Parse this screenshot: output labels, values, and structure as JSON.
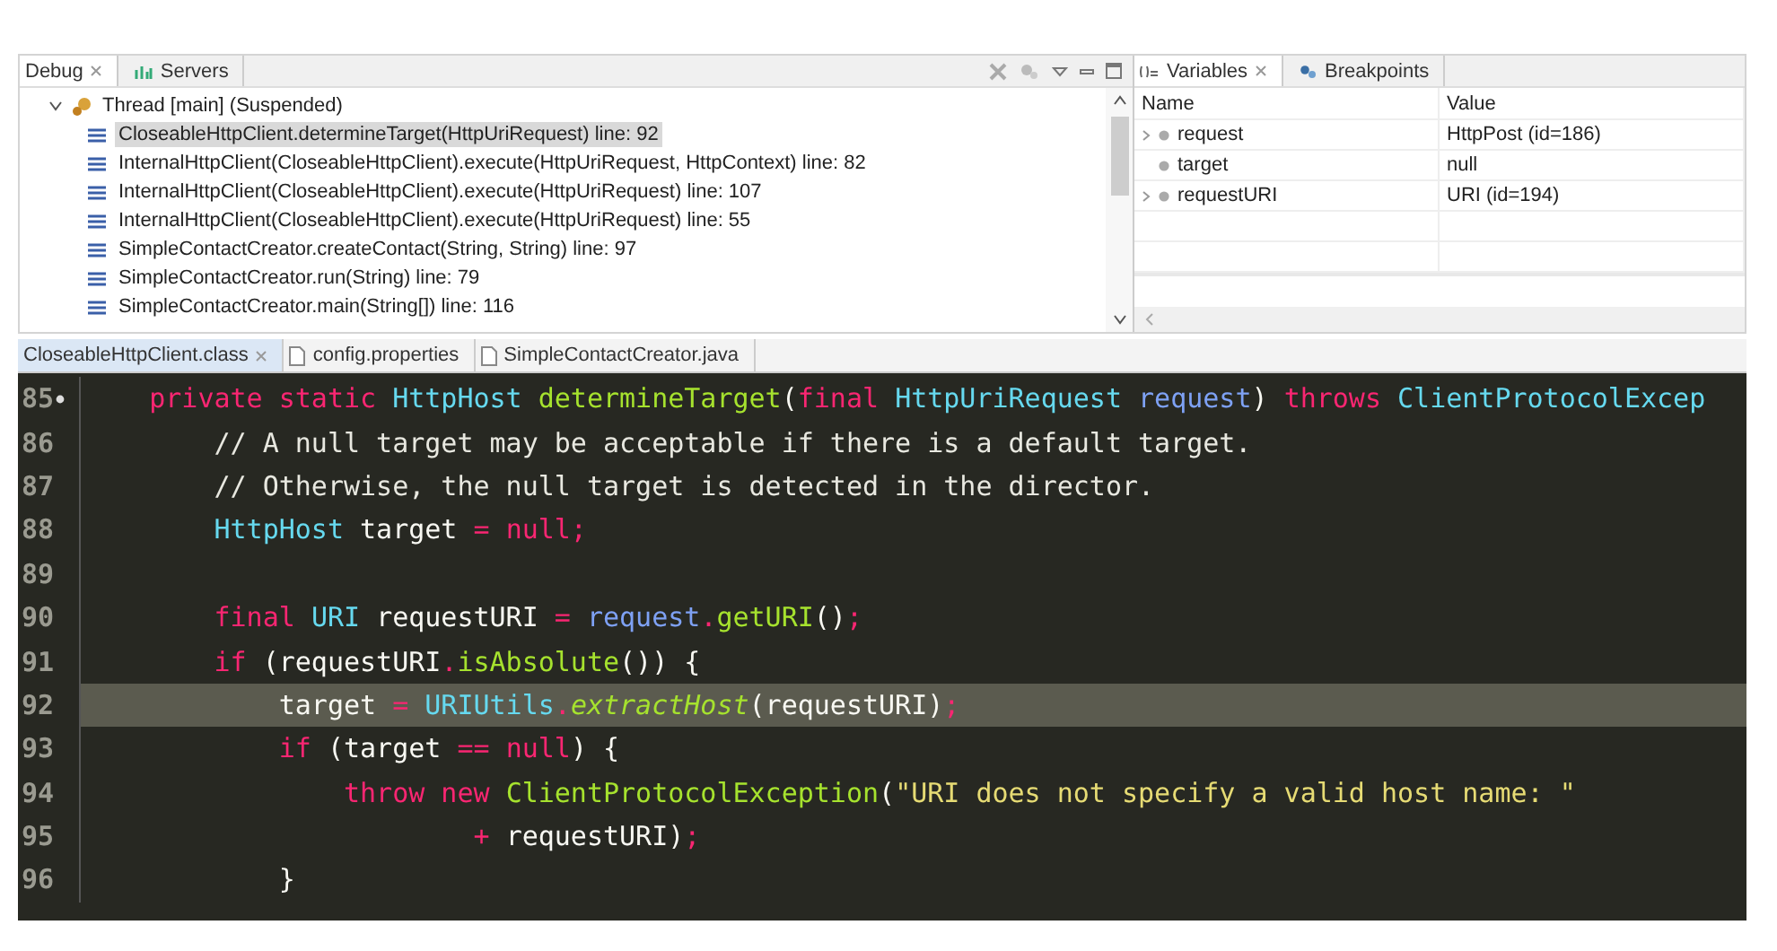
{
  "debug_view": {
    "tabs": [
      {
        "label": "Debug",
        "selected": true
      },
      {
        "label": "Servers",
        "selected": false
      }
    ],
    "thread": {
      "label": "Thread [main] (Suspended)",
      "expanded": true,
      "children": [
        {
          "label": "CloseableHttpClient.determineTarget(HttpUriRequest) line: 92",
          "selected": true
        },
        {
          "label": "InternalHttpClient(CloseableHttpClient).execute(HttpUriRequest, HttpContext) line: 82",
          "selected": false
        },
        {
          "label": "InternalHttpClient(CloseableHttpClient).execute(HttpUriRequest) line: 107",
          "selected": false
        },
        {
          "label": "InternalHttpClient(CloseableHttpClient).execute(HttpUriRequest) line: 55",
          "selected": false
        },
        {
          "label": "SimpleContactCreator.createContact(String, String) line: 97",
          "selected": false
        },
        {
          "label": "SimpleContactCreator.run(String) line: 79",
          "selected": false
        },
        {
          "label": "SimpleContactCreator.main(String[]) line: 116",
          "selected": false
        }
      ]
    }
  },
  "variables_view": {
    "tabs": [
      {
        "label": "Variables",
        "selected": true
      },
      {
        "label": "Breakpoints",
        "selected": false
      }
    ],
    "columns": [
      "Name",
      "Value"
    ],
    "rows": [
      {
        "name": "request",
        "value": "HttpPost  (id=186)",
        "expandable": true
      },
      {
        "name": "target",
        "value": "null",
        "expandable": false
      },
      {
        "name": "requestURI",
        "value": "URI  (id=194)",
        "expandable": true
      }
    ]
  },
  "editor": {
    "tabs": [
      {
        "label": "CloseableHttpClient.class",
        "selected": true,
        "closable": true
      },
      {
        "label": "config.properties",
        "selected": false,
        "closable": false
      },
      {
        "label": "SimpleContactCreator.java",
        "selected": false,
        "closable": false
      }
    ],
    "lines": [
      {
        "number": "85",
        "marker": true,
        "current": false,
        "tokens": [
          {
            "kind": "keyword",
            "text": "    private static "
          },
          {
            "kind": "type",
            "text": "HttpHost "
          },
          {
            "kind": "method",
            "text": "determineTarget"
          },
          {
            "kind": "plain",
            "text": "("
          },
          {
            "kind": "keyword",
            "text": "final "
          },
          {
            "kind": "type",
            "text": "HttpUriRequest "
          },
          {
            "kind": "param",
            "text": "request"
          },
          {
            "kind": "plain",
            "text": ") "
          },
          {
            "kind": "keyword",
            "text": "throws "
          },
          {
            "kind": "type",
            "text": "ClientProtocolExcep"
          }
        ]
      },
      {
        "number": "86",
        "marker": false,
        "current": false,
        "tokens": [
          {
            "kind": "comment",
            "text": "        // A null target may be acceptable if there is a default target."
          }
        ]
      },
      {
        "number": "87",
        "marker": false,
        "current": false,
        "tokens": [
          {
            "kind": "comment",
            "text": "        // Otherwise, the null target is detected in the director."
          }
        ]
      },
      {
        "number": "88",
        "marker": false,
        "current": false,
        "tokens": [
          {
            "kind": "type",
            "text": "        HttpHost "
          },
          {
            "kind": "plain",
            "text": "target "
          },
          {
            "kind": "operator",
            "text": "= "
          },
          {
            "kind": "keyword",
            "text": "null;"
          }
        ]
      },
      {
        "number": "89",
        "marker": false,
        "current": false
      },
      {
        "number": "90",
        "marker": false,
        "current": false,
        "tokens": [
          {
            "kind": "keyword",
            "text": "        final "
          },
          {
            "kind": "type",
            "text": "URI "
          },
          {
            "kind": "plain",
            "text": "requestURI "
          },
          {
            "kind": "operator",
            "text": "= "
          },
          {
            "kind": "param",
            "text": "request"
          },
          {
            "kind": "operator",
            "text": "."
          },
          {
            "kind": "method",
            "text": "getURI"
          },
          {
            "kind": "plain",
            "text": "()"
          },
          {
            "kind": "operator",
            "text": ";"
          }
        ]
      },
      {
        "number": "91",
        "marker": false,
        "current": false,
        "tokens": [
          {
            "kind": "keyword",
            "text": "        if "
          },
          {
            "kind": "plain",
            "text": "(requestURI"
          },
          {
            "kind": "operator",
            "text": "."
          },
          {
            "kind": "method",
            "text": "isAbsolute"
          },
          {
            "kind": "plain",
            "text": "()) {"
          }
        ]
      },
      {
        "number": "92",
        "marker": false,
        "current": true,
        "tokens": [
          {
            "kind": "plain",
            "text": "            target "
          },
          {
            "kind": "operator",
            "text": "= "
          },
          {
            "kind": "type",
            "text": "URIUtils"
          },
          {
            "kind": "operator",
            "text": "."
          },
          {
            "kind": "static",
            "text": "extractHost"
          },
          {
            "kind": "plain",
            "text": "(requestURI)"
          },
          {
            "kind": "operator",
            "text": ";"
          }
        ]
      },
      {
        "number": "93",
        "marker": false,
        "current": false,
        "tokens": [
          {
            "kind": "keyword",
            "text": "            if "
          },
          {
            "kind": "plain",
            "text": "(target "
          },
          {
            "kind": "operator",
            "text": "== "
          },
          {
            "kind": "keyword",
            "text": "null"
          },
          {
            "kind": "plain",
            "text": ") {"
          }
        ]
      },
      {
        "number": "94",
        "marker": false,
        "current": false,
        "tokens": [
          {
            "kind": "keyword",
            "text": "                throw new "
          },
          {
            "kind": "method",
            "text": "ClientProtocolException"
          },
          {
            "kind": "plain",
            "text": "("
          },
          {
            "kind": "string",
            "text": "\"URI does not specify a valid host name: \""
          }
        ]
      },
      {
        "number": "95",
        "marker": false,
        "current": false,
        "tokens": [
          {
            "kind": "operator",
            "text": "                        + "
          },
          {
            "kind": "plain",
            "text": "requestURI)"
          },
          {
            "kind": "operator",
            "text": ";"
          }
        ]
      },
      {
        "number": "96",
        "marker": false,
        "current": false,
        "tokens": [
          {
            "kind": "plain",
            "text": "            }"
          }
        ]
      }
    ]
  }
}
